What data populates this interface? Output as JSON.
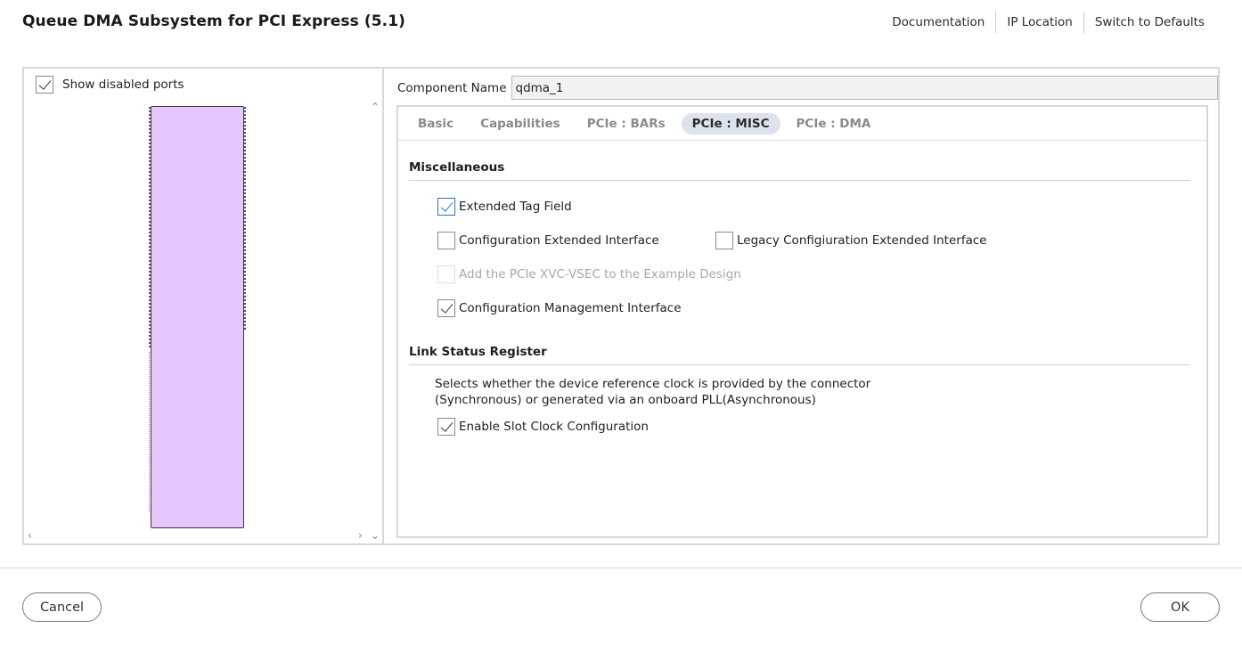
{
  "window": {
    "title": "Queue DMA Subsystem for PCI Express (5.1)"
  },
  "toplinks": [
    "Documentation",
    "IP Location",
    "Switch to Defaults"
  ],
  "left_panel": {
    "show_disabled_ports": {
      "label": "Show disabled ports",
      "checked": true
    }
  },
  "component": {
    "label": "Component Name",
    "value": "qdma_1"
  },
  "tabs": [
    {
      "label": "Basic"
    },
    {
      "label": "Capabilities"
    },
    {
      "label": "PCIe : BARs"
    },
    {
      "label": "PCIe : MISC",
      "active": true
    },
    {
      "label": "PCIe : DMA"
    }
  ],
  "misc": {
    "heading": "Miscellaneous",
    "extended_tag": {
      "label": "Extended Tag Field",
      "checked": true
    },
    "config_ext": {
      "label": "Configuration Extended Interface",
      "checked": false
    },
    "legacy_config_ext": {
      "label": "Legacy Configiuration Extended Interface",
      "checked": false
    },
    "xvc_vsec": {
      "label": "Add the PCIe XVC-VSEC to the Example Design",
      "checked": false,
      "disabled": true
    },
    "config_mgmt": {
      "label": "Configuration Management Interface",
      "checked": true
    }
  },
  "link_status": {
    "heading": "Link Status Register",
    "desc_line1": "Selects whether the device reference clock is provided by the connector",
    "desc_line2": "(Synchronous) or generated via an onboard PLL(Asynchronous)",
    "slot_clock": {
      "label": "Enable Slot Clock Configuration",
      "checked": true
    }
  },
  "buttons": {
    "cancel": "Cancel",
    "ok": "OK"
  },
  "colors": {
    "block_fill": "#e6c6ff",
    "active_tab": "#dde3ee",
    "focus": "#2f6fc9"
  }
}
